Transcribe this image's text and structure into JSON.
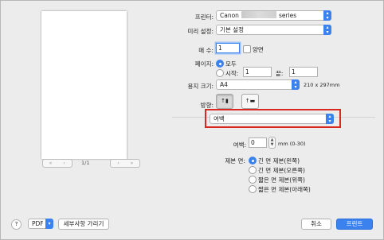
{
  "preview": {
    "page_indicator": "1/1",
    "nav_first": "«",
    "nav_prev": "‹",
    "nav_next": "›",
    "nav_last": "»"
  },
  "printer": {
    "label": "프린터:",
    "value_prefix": "Canon",
    "value_suffix": "series"
  },
  "presets": {
    "label": "미리 설정:",
    "value": "기본 설정"
  },
  "copies": {
    "label": "매 수:",
    "value": "1",
    "duplex_label": "양면"
  },
  "pages": {
    "label": "페이지:",
    "all_label": "모두",
    "from_label": "시작:",
    "from_value": "1",
    "to_label": "끝:",
    "to_value": "1"
  },
  "paper_size": {
    "label": "용지 크기:",
    "value": "A4",
    "dimensions": "210 x 297mm"
  },
  "orientation": {
    "label": "방향:"
  },
  "panel_select": {
    "value": "여백"
  },
  "margin": {
    "label": "여백:",
    "value": "0",
    "unit_range": "mm (0-30)"
  },
  "binding": {
    "label": "제본 면:",
    "options": [
      "긴 면 제본(왼쪽)",
      "긴 면 제본(오른쪽)",
      "짧은 면 제본(위쪽)",
      "짧은 면 제본(아래쪽)"
    ],
    "selected_index": 0
  },
  "footer": {
    "help": "?",
    "pdf_label": "PDF",
    "details_label": "세부사항 가리기",
    "cancel_label": "취소",
    "print_label": "프린트"
  },
  "colors": {
    "accent": "#3b82ef",
    "highlight": "#d8281f"
  },
  "icons": {
    "popup_arrows": "updown-chevron-icon",
    "portrait": "portrait-orientation-icon",
    "landscape": "landscape-orientation-icon"
  }
}
